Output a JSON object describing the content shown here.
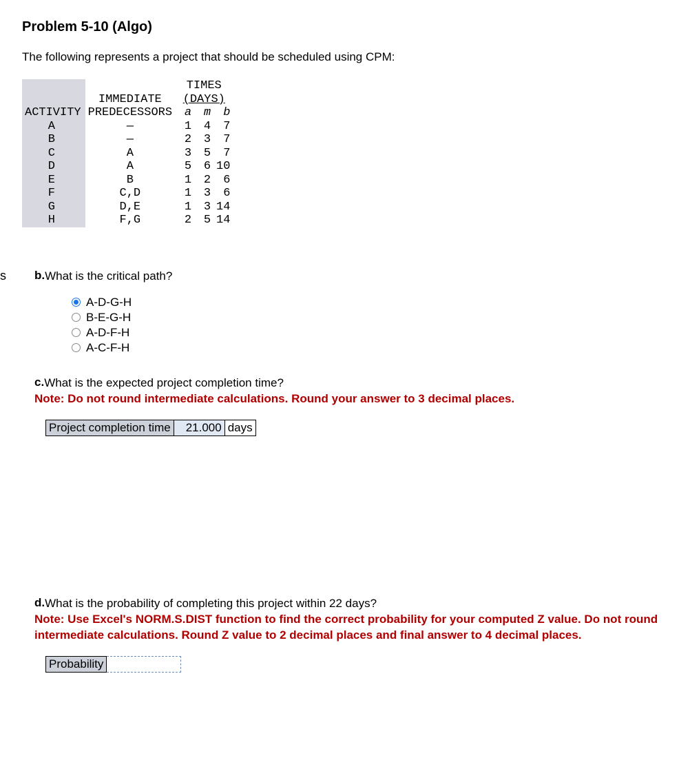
{
  "title": "Problem 5-10 (Algo)",
  "intro": "The following represents a project that should be scheduled using CPM:",
  "table": {
    "header": {
      "times": "TIMES",
      "days": "(DAYS)",
      "activity": "ACTIVITY",
      "immediate": "IMMEDIATE",
      "predecessors": "PREDECESSORS",
      "a": "a",
      "m": "m",
      "b": "b"
    },
    "rows": [
      {
        "activity": "A",
        "pred": "—",
        "a": "1",
        "m": "4",
        "b": "7"
      },
      {
        "activity": "B",
        "pred": "—",
        "a": "2",
        "m": "3",
        "b": "7"
      },
      {
        "activity": "C",
        "pred": "A",
        "a": "3",
        "m": "5",
        "b": "7"
      },
      {
        "activity": "D",
        "pred": "A",
        "a": "5",
        "m": "6",
        "b": "10"
      },
      {
        "activity": "E",
        "pred": "B",
        "a": "1",
        "m": "2",
        "b": "6"
      },
      {
        "activity": "F",
        "pred": "C,D",
        "a": "1",
        "m": "3",
        "b": "6"
      },
      {
        "activity": "G",
        "pred": "D,E",
        "a": "1",
        "m": "3",
        "b": "14"
      },
      {
        "activity": "H",
        "pred": "F,G",
        "a": "2",
        "m": "5",
        "b": "14"
      }
    ]
  },
  "partB": {
    "margin_s": "s",
    "label": "b.",
    "question": "What is the critical path?",
    "options": [
      "A-D-G-H",
      "B-E-G-H",
      "A-D-F-H",
      "A-C-F-H"
    ],
    "selected": 0
  },
  "partC": {
    "label": "c.",
    "question": "What is the expected project completion time?",
    "note": "Note: Do not round intermediate calculations. Round your answer to 3 decimal places.",
    "answer": {
      "label": "Project completion time",
      "value": "21.000",
      "unit": "days"
    }
  },
  "partD": {
    "label": "d.",
    "question": "What is the probability of completing this project within 22 days?",
    "note": "Note: Use Excel's NORM.S.DIST function to find the correct probability for your computed Z value. Do not round intermediate calculations. Round Z value to 2 decimal places and final answer to 4 decimal places.",
    "answer": {
      "label": "Probability",
      "value": ""
    }
  }
}
